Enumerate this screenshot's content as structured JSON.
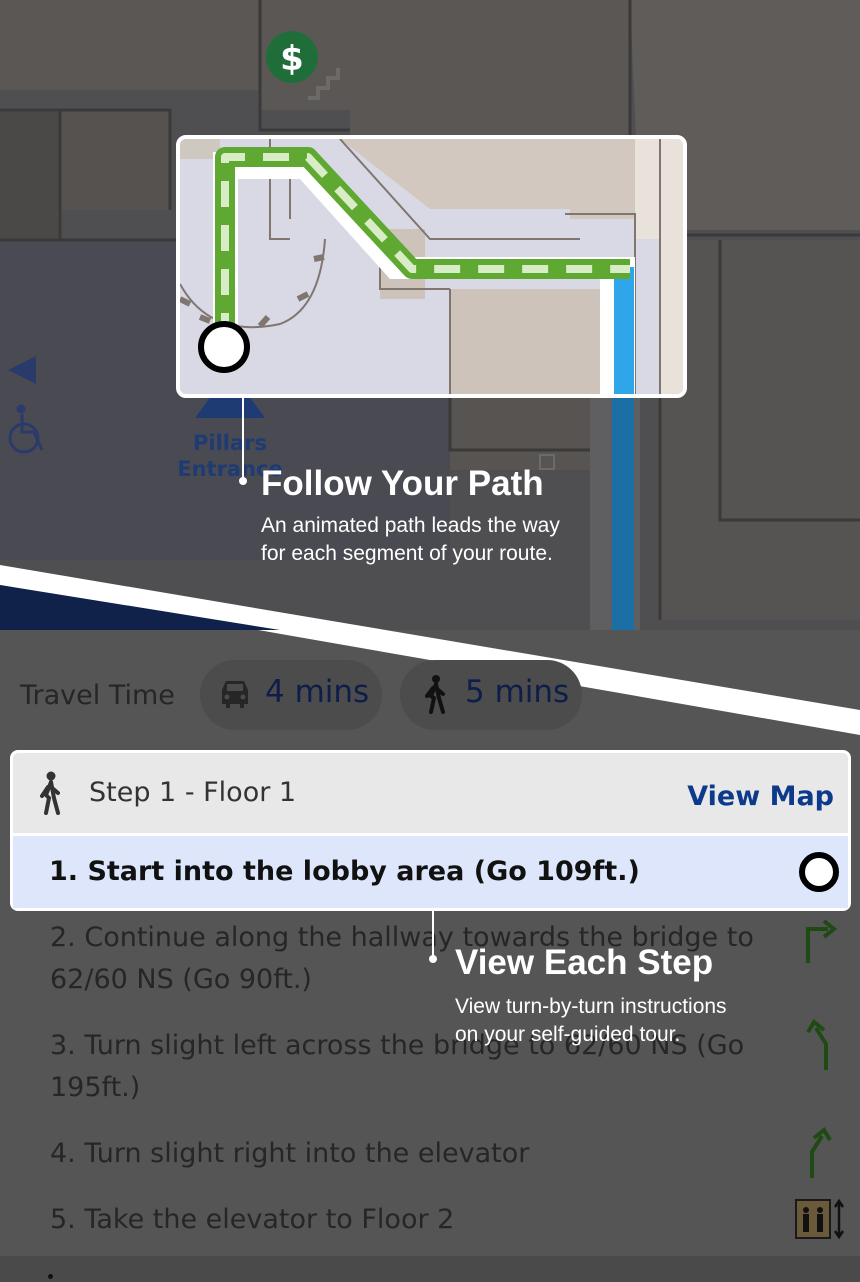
{
  "map": {
    "entrance_label_line1": "Pillars",
    "entrance_label_line2": "Entrance",
    "icons": [
      "atm-dollar-icon",
      "stairs-icon",
      "wheelchair-icon",
      "arrow-left-icon"
    ]
  },
  "callouts": {
    "path": {
      "title": "Follow Your Path",
      "desc_line1": "An animated path leads the way",
      "desc_line2": "for each segment of your route."
    },
    "steps": {
      "title": "View Each Step",
      "desc_line1": "View turn-by-turn instructions",
      "desc_line2": "on your self-guided tour."
    }
  },
  "travel_time": {
    "label": "Travel Time",
    "drive": "4 mins",
    "walk": "5 mins"
  },
  "step_card": {
    "title": "Step 1 - Floor 1",
    "view_map": "View Map",
    "step_1": "1. Start into the lobby area (Go 109ft.)"
  },
  "steps": [
    {
      "line1": "2. Continue along the hallway towards the bridge to",
      "line2": "62/60 NS (Go 90ft.)",
      "icon": "turn-right-icon"
    },
    {
      "line1": "3. Turn slight left across the bridge to 62/60 NS (Go",
      "line2": "195ft.)",
      "icon": "slight-left-icon"
    },
    {
      "line1": "4. Turn slight right into the elevator",
      "line2": "",
      "icon": "slight-right-icon"
    },
    {
      "line1": "5. Take the elevator to Floor 2",
      "line2": "",
      "icon": "elevator-icon"
    }
  ],
  "colors": {
    "route_green": "#5fa832",
    "route_blue": "#2fa5ea",
    "link_blue": "#0d3a8a",
    "step_highlight": "#dde6fb",
    "atm_green": "#1f6e3a"
  }
}
